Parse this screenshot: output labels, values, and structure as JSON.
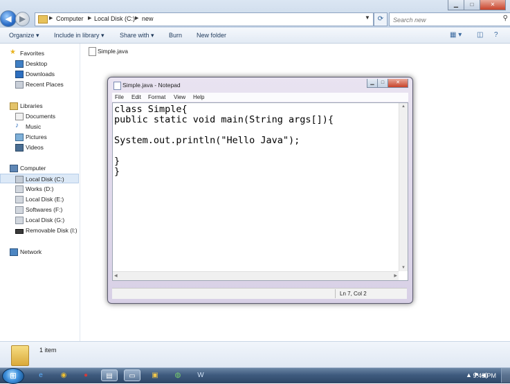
{
  "explorer": {
    "breadcrumb": [
      "Computer",
      "Local Disk (C:)",
      "new"
    ],
    "search_placeholder": "Search new",
    "window_controls": {
      "minimize": "▁",
      "maximize": "□",
      "close": "✕"
    },
    "toolbar": {
      "organize": "Organize ▾",
      "include_in_library": "Include in library ▾",
      "share_with": "Share with ▾",
      "burn": "Burn",
      "new_folder": "New folder"
    },
    "nav": {
      "favorites": {
        "label": "Favorites",
        "items": [
          "Desktop",
          "Downloads",
          "Recent Places"
        ]
      },
      "libraries": {
        "label": "Libraries",
        "items": [
          "Documents",
          "Music",
          "Pictures",
          "Videos"
        ]
      },
      "computer": {
        "label": "Computer",
        "items": [
          "Local Disk (C:)",
          "Works (D:)",
          "Local Disk (E:)",
          "Softwares (F:)",
          "Local Disk (G:)",
          "Removable Disk (I:)"
        ]
      },
      "network": {
        "label": "Network"
      }
    },
    "files": [
      {
        "name": "Simple.java"
      }
    ],
    "details": {
      "count": "1 item"
    }
  },
  "notepad": {
    "title": "Simple.java - Notepad",
    "menu": [
      "File",
      "Edit",
      "Format",
      "View",
      "Help"
    ],
    "content": "class Simple{\npublic static void main(String args[]){\n\nSystem.out.println(\"Hello Java\");\n\n}\n}",
    "status": "Ln 7, Col 2"
  },
  "taskbar": {
    "start_icon": "windows-orb",
    "clock": "9:45 PM",
    "tray_icons": [
      "▲",
      "⚑",
      "◀)"
    ]
  },
  "colors": {
    "explorer_chrome": "#cfdcec",
    "notepad_frame": "#d8d0e6",
    "taskbar": "#3f5b7e"
  }
}
